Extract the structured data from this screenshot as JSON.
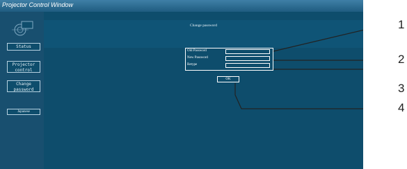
{
  "window": {
    "title": "Projector Control Window"
  },
  "sidebar": {
    "buttons": [
      {
        "line1": "Status",
        "line2": ""
      },
      {
        "line1": "Projector",
        "line2": "control"
      },
      {
        "line1": "Change",
        "line2": "password"
      },
      {
        "line1": "Japanese",
        "line2": ""
      }
    ]
  },
  "main": {
    "title": "Change password",
    "fields": [
      {
        "label": "Old Password",
        "value": ""
      },
      {
        "label": "New Password",
        "value": ""
      },
      {
        "label": "Retype",
        "value": ""
      }
    ],
    "ok_label": "OK"
  },
  "callouts": [
    "1",
    "2",
    "3",
    "4"
  ],
  "colors": {
    "background": "#0e4d6c",
    "sidebar": "#184f6f",
    "titlebar": "#2e6f97"
  }
}
